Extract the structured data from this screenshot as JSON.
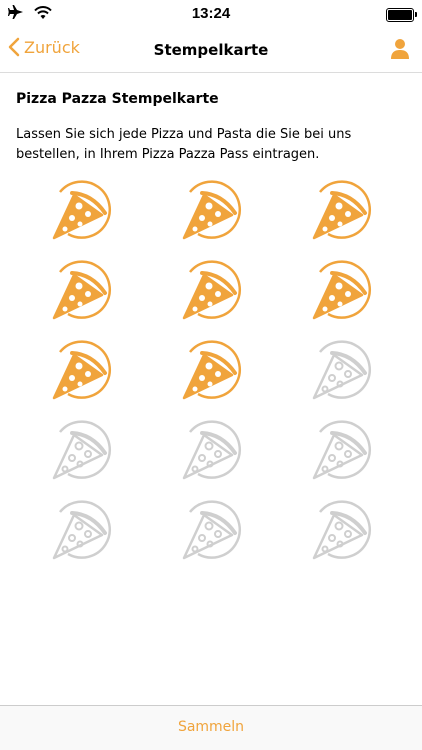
{
  "status_bar": {
    "time": "13:24",
    "battery_level": 1.0,
    "icons": [
      "airplane-icon",
      "wifi-icon",
      "battery-icon"
    ]
  },
  "nav": {
    "back_label": "Zurück",
    "title": "Stempelkarte",
    "profile_icon": "person-icon"
  },
  "card": {
    "title": "Pizza Pazza Stempelkarte",
    "description": "Lassen Sie sich jede Pizza und Pasta die Sie bei uns bestellen, in Ihrem Pizza Pazza Pass eintragen."
  },
  "stamps": {
    "total": 15,
    "collected": 8,
    "icon": "pizza-slice-icon",
    "active_color": "#f0a43c",
    "inactive_color": "#cfcfcf"
  },
  "tab_bar": {
    "collect_label": "Sammeln"
  },
  "colors": {
    "accent": "#f0a43c"
  }
}
